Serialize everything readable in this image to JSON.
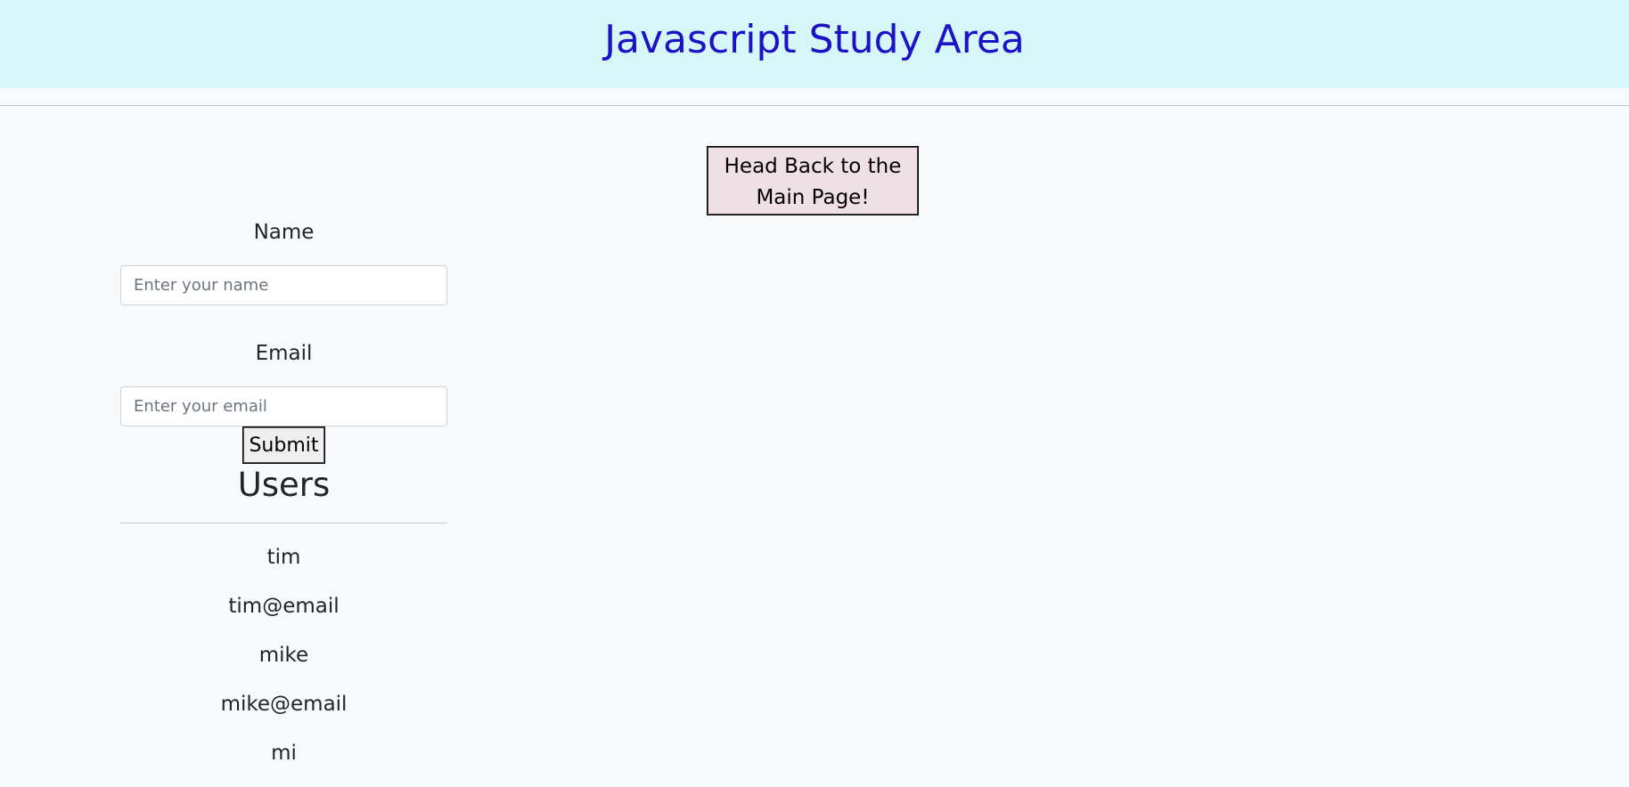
{
  "header": {
    "title": "Javascript Study Area"
  },
  "nav": {
    "back_label": "Head Back to the Main Page!"
  },
  "form": {
    "name_label": "Name",
    "name_placeholder": "Enter your name",
    "name_value": "",
    "email_label": "Email",
    "email_placeholder": "Enter your email",
    "email_value": "",
    "submit_label": "Submit"
  },
  "users": {
    "title": "Users",
    "items": [
      "tim",
      "tim@email",
      "mike",
      "mike@email",
      "mi"
    ]
  },
  "colors": {
    "header_bg": "#d5f7f8",
    "title": "#1d12c6",
    "back_button_bg": "#efe0e6",
    "page_bg": "#f8f9fb"
  }
}
